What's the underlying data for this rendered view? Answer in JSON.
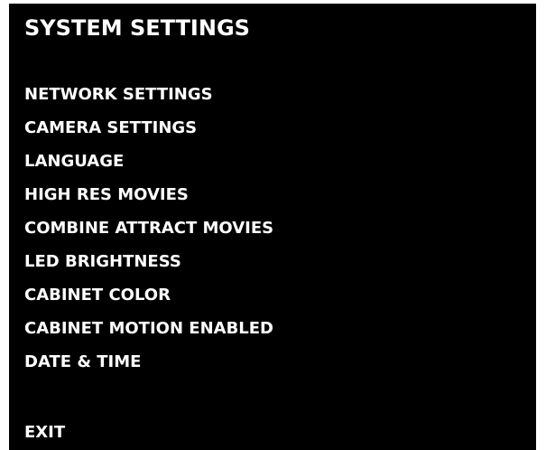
{
  "screen": {
    "title": "SYSTEM SETTINGS",
    "menu_items": [
      "NETWORK SETTINGS",
      "CAMERA SETTINGS",
      "LANGUAGE",
      "HIGH RES MOVIES",
      "COMBINE ATTRACT MOVIES",
      "LED BRIGHTNESS",
      "CABINET COLOR",
      "CABINET MOTION ENABLED",
      "DATE & TIME"
    ],
    "exit_label": "EXIT"
  },
  "colors": {
    "background": "#000000",
    "text": "#ffffff"
  }
}
